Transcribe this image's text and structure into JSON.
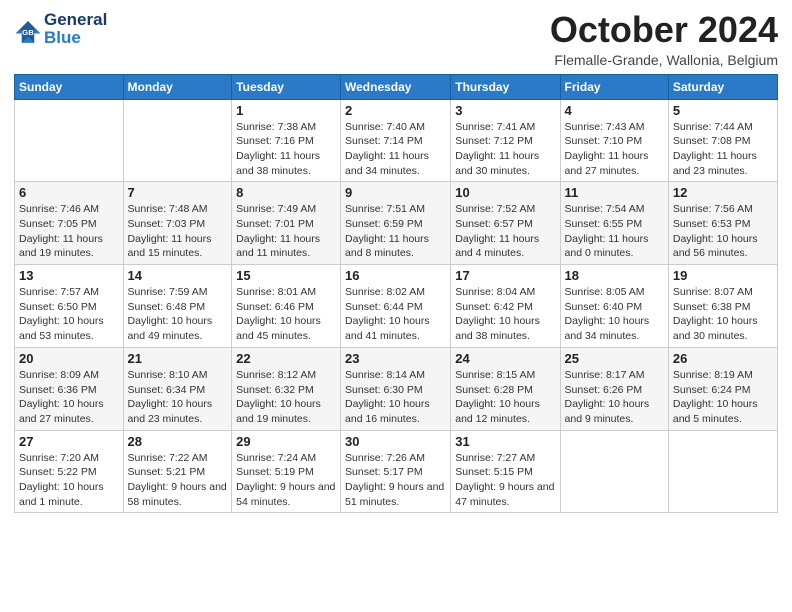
{
  "header": {
    "logo_general": "General",
    "logo_blue": "Blue",
    "month_title": "October 2024",
    "subtitle": "Flemalle-Grande, Wallonia, Belgium"
  },
  "days_of_week": [
    "Sunday",
    "Monday",
    "Tuesday",
    "Wednesday",
    "Thursday",
    "Friday",
    "Saturday"
  ],
  "weeks": [
    [
      {
        "day": "",
        "info": ""
      },
      {
        "day": "",
        "info": ""
      },
      {
        "day": "1",
        "info": "Sunrise: 7:38 AM\nSunset: 7:16 PM\nDaylight: 11 hours and 38 minutes."
      },
      {
        "day": "2",
        "info": "Sunrise: 7:40 AM\nSunset: 7:14 PM\nDaylight: 11 hours and 34 minutes."
      },
      {
        "day": "3",
        "info": "Sunrise: 7:41 AM\nSunset: 7:12 PM\nDaylight: 11 hours and 30 minutes."
      },
      {
        "day": "4",
        "info": "Sunrise: 7:43 AM\nSunset: 7:10 PM\nDaylight: 11 hours and 27 minutes."
      },
      {
        "day": "5",
        "info": "Sunrise: 7:44 AM\nSunset: 7:08 PM\nDaylight: 11 hours and 23 minutes."
      }
    ],
    [
      {
        "day": "6",
        "info": "Sunrise: 7:46 AM\nSunset: 7:05 PM\nDaylight: 11 hours and 19 minutes."
      },
      {
        "day": "7",
        "info": "Sunrise: 7:48 AM\nSunset: 7:03 PM\nDaylight: 11 hours and 15 minutes."
      },
      {
        "day": "8",
        "info": "Sunrise: 7:49 AM\nSunset: 7:01 PM\nDaylight: 11 hours and 11 minutes."
      },
      {
        "day": "9",
        "info": "Sunrise: 7:51 AM\nSunset: 6:59 PM\nDaylight: 11 hours and 8 minutes."
      },
      {
        "day": "10",
        "info": "Sunrise: 7:52 AM\nSunset: 6:57 PM\nDaylight: 11 hours and 4 minutes."
      },
      {
        "day": "11",
        "info": "Sunrise: 7:54 AM\nSunset: 6:55 PM\nDaylight: 11 hours and 0 minutes."
      },
      {
        "day": "12",
        "info": "Sunrise: 7:56 AM\nSunset: 6:53 PM\nDaylight: 10 hours and 56 minutes."
      }
    ],
    [
      {
        "day": "13",
        "info": "Sunrise: 7:57 AM\nSunset: 6:50 PM\nDaylight: 10 hours and 53 minutes."
      },
      {
        "day": "14",
        "info": "Sunrise: 7:59 AM\nSunset: 6:48 PM\nDaylight: 10 hours and 49 minutes."
      },
      {
        "day": "15",
        "info": "Sunrise: 8:01 AM\nSunset: 6:46 PM\nDaylight: 10 hours and 45 minutes."
      },
      {
        "day": "16",
        "info": "Sunrise: 8:02 AM\nSunset: 6:44 PM\nDaylight: 10 hours and 41 minutes."
      },
      {
        "day": "17",
        "info": "Sunrise: 8:04 AM\nSunset: 6:42 PM\nDaylight: 10 hours and 38 minutes."
      },
      {
        "day": "18",
        "info": "Sunrise: 8:05 AM\nSunset: 6:40 PM\nDaylight: 10 hours and 34 minutes."
      },
      {
        "day": "19",
        "info": "Sunrise: 8:07 AM\nSunset: 6:38 PM\nDaylight: 10 hours and 30 minutes."
      }
    ],
    [
      {
        "day": "20",
        "info": "Sunrise: 8:09 AM\nSunset: 6:36 PM\nDaylight: 10 hours and 27 minutes."
      },
      {
        "day": "21",
        "info": "Sunrise: 8:10 AM\nSunset: 6:34 PM\nDaylight: 10 hours and 23 minutes."
      },
      {
        "day": "22",
        "info": "Sunrise: 8:12 AM\nSunset: 6:32 PM\nDaylight: 10 hours and 19 minutes."
      },
      {
        "day": "23",
        "info": "Sunrise: 8:14 AM\nSunset: 6:30 PM\nDaylight: 10 hours and 16 minutes."
      },
      {
        "day": "24",
        "info": "Sunrise: 8:15 AM\nSunset: 6:28 PM\nDaylight: 10 hours and 12 minutes."
      },
      {
        "day": "25",
        "info": "Sunrise: 8:17 AM\nSunset: 6:26 PM\nDaylight: 10 hours and 9 minutes."
      },
      {
        "day": "26",
        "info": "Sunrise: 8:19 AM\nSunset: 6:24 PM\nDaylight: 10 hours and 5 minutes."
      }
    ],
    [
      {
        "day": "27",
        "info": "Sunrise: 7:20 AM\nSunset: 5:22 PM\nDaylight: 10 hours and 1 minute."
      },
      {
        "day": "28",
        "info": "Sunrise: 7:22 AM\nSunset: 5:21 PM\nDaylight: 9 hours and 58 minutes."
      },
      {
        "day": "29",
        "info": "Sunrise: 7:24 AM\nSunset: 5:19 PM\nDaylight: 9 hours and 54 minutes."
      },
      {
        "day": "30",
        "info": "Sunrise: 7:26 AM\nSunset: 5:17 PM\nDaylight: 9 hours and 51 minutes."
      },
      {
        "day": "31",
        "info": "Sunrise: 7:27 AM\nSunset: 5:15 PM\nDaylight: 9 hours and 47 minutes."
      },
      {
        "day": "",
        "info": ""
      },
      {
        "day": "",
        "info": ""
      }
    ]
  ]
}
